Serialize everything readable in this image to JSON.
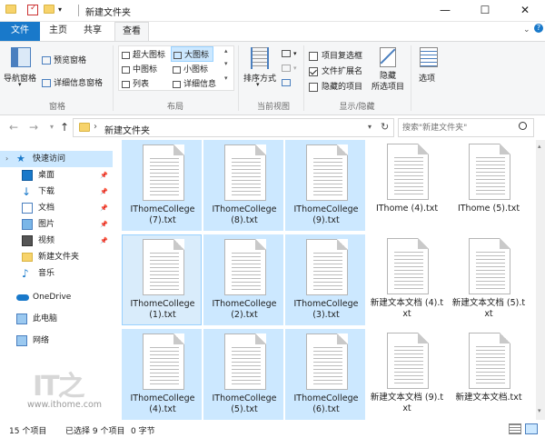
{
  "window": {
    "title": "新建文件夹",
    "controls": {
      "minimize": "—",
      "maximize": "☐",
      "close": "✕"
    }
  },
  "ribbon_tabs": [
    "文件",
    "主页",
    "共享",
    "查看"
  ],
  "ribbon": {
    "pane_group": {
      "label": "窗格",
      "nav_pane": "导航窗格",
      "preview_pane": "预览窗格",
      "details_pane": "详细信息窗格"
    },
    "layout_group": {
      "label": "布局",
      "options": [
        "超大图标",
        "大图标",
        "中图标",
        "小图标",
        "列表",
        "详细信息"
      ],
      "selected": "大图标"
    },
    "current_view_group": {
      "label": "当前视图",
      "sort_by": "排序方式"
    },
    "show_hide_group": {
      "label": "显示/隐藏",
      "checkboxes": [
        {
          "label": "项目复选框",
          "checked": false
        },
        {
          "label": "文件扩展名",
          "checked": true
        },
        {
          "label": "隐藏的项目",
          "checked": false
        }
      ],
      "hide_selected": "隐藏\n所选项目"
    },
    "options": {
      "label": "选项"
    }
  },
  "address": {
    "path": "新建文件夹",
    "search_placeholder": "搜索\"新建文件夹\""
  },
  "nav_pane": {
    "items": [
      {
        "label": "快速访问",
        "icon": "star-icon",
        "selected": true,
        "pinned": false
      },
      {
        "label": "桌面",
        "icon": "desktop-icon",
        "selected": false,
        "pinned": true
      },
      {
        "label": "下载",
        "icon": "download-icon",
        "selected": false,
        "pinned": true
      },
      {
        "label": "文档",
        "icon": "document-icon",
        "selected": false,
        "pinned": true
      },
      {
        "label": "图片",
        "icon": "picture-icon",
        "selected": false,
        "pinned": true
      },
      {
        "label": "视频",
        "icon": "video-icon",
        "selected": false,
        "pinned": true
      },
      {
        "label": "新建文件夹",
        "icon": "folder-icon",
        "selected": false,
        "pinned": false
      },
      {
        "label": "音乐",
        "icon": "music-icon",
        "selected": false,
        "pinned": false
      },
      {
        "label": "OneDrive",
        "icon": "cloud-icon",
        "selected": false,
        "pinned": false
      },
      {
        "label": "此电脑",
        "icon": "computer-icon",
        "selected": false,
        "pinned": false
      },
      {
        "label": "网络",
        "icon": "network-icon",
        "selected": false,
        "pinned": false
      }
    ]
  },
  "files": [
    {
      "name": "IThomeCollege (7).txt",
      "selected": true
    },
    {
      "name": "IThomeCollege (8).txt",
      "selected": true
    },
    {
      "name": "IThomeCollege (9).txt",
      "selected": true
    },
    {
      "name": "IThome (4).txt",
      "selected": false
    },
    {
      "name": "IThome (5).txt",
      "selected": false
    },
    {
      "name": "IThomeCollege (1).txt",
      "selected": true
    },
    {
      "name": "IThomeCollege (2).txt",
      "selected": true
    },
    {
      "name": "IThomeCollege (3).txt",
      "selected": true
    },
    {
      "name": "新建文本文档 (4).txt",
      "selected": false
    },
    {
      "name": "新建文本文档 (5).txt",
      "selected": false
    },
    {
      "name": "IThomeCollege (4).txt",
      "selected": true
    },
    {
      "name": "IThomeCollege (5).txt",
      "selected": true
    },
    {
      "name": "IThomeCollege (6).txt",
      "selected": true
    },
    {
      "name": "新建文本文档 (9).txt",
      "selected": false
    },
    {
      "name": "新建文本文档.txt",
      "selected": false
    }
  ],
  "status": {
    "item_count": "15 个项目",
    "selected": "已选择 9 个项目",
    "size": "0 字节"
  },
  "watermark": {
    "logo": "IT之",
    "url": "www.ithome.com"
  },
  "colors": {
    "accent": "#1979ca",
    "selection": "#cce8ff",
    "folder": "#f7d36b"
  }
}
